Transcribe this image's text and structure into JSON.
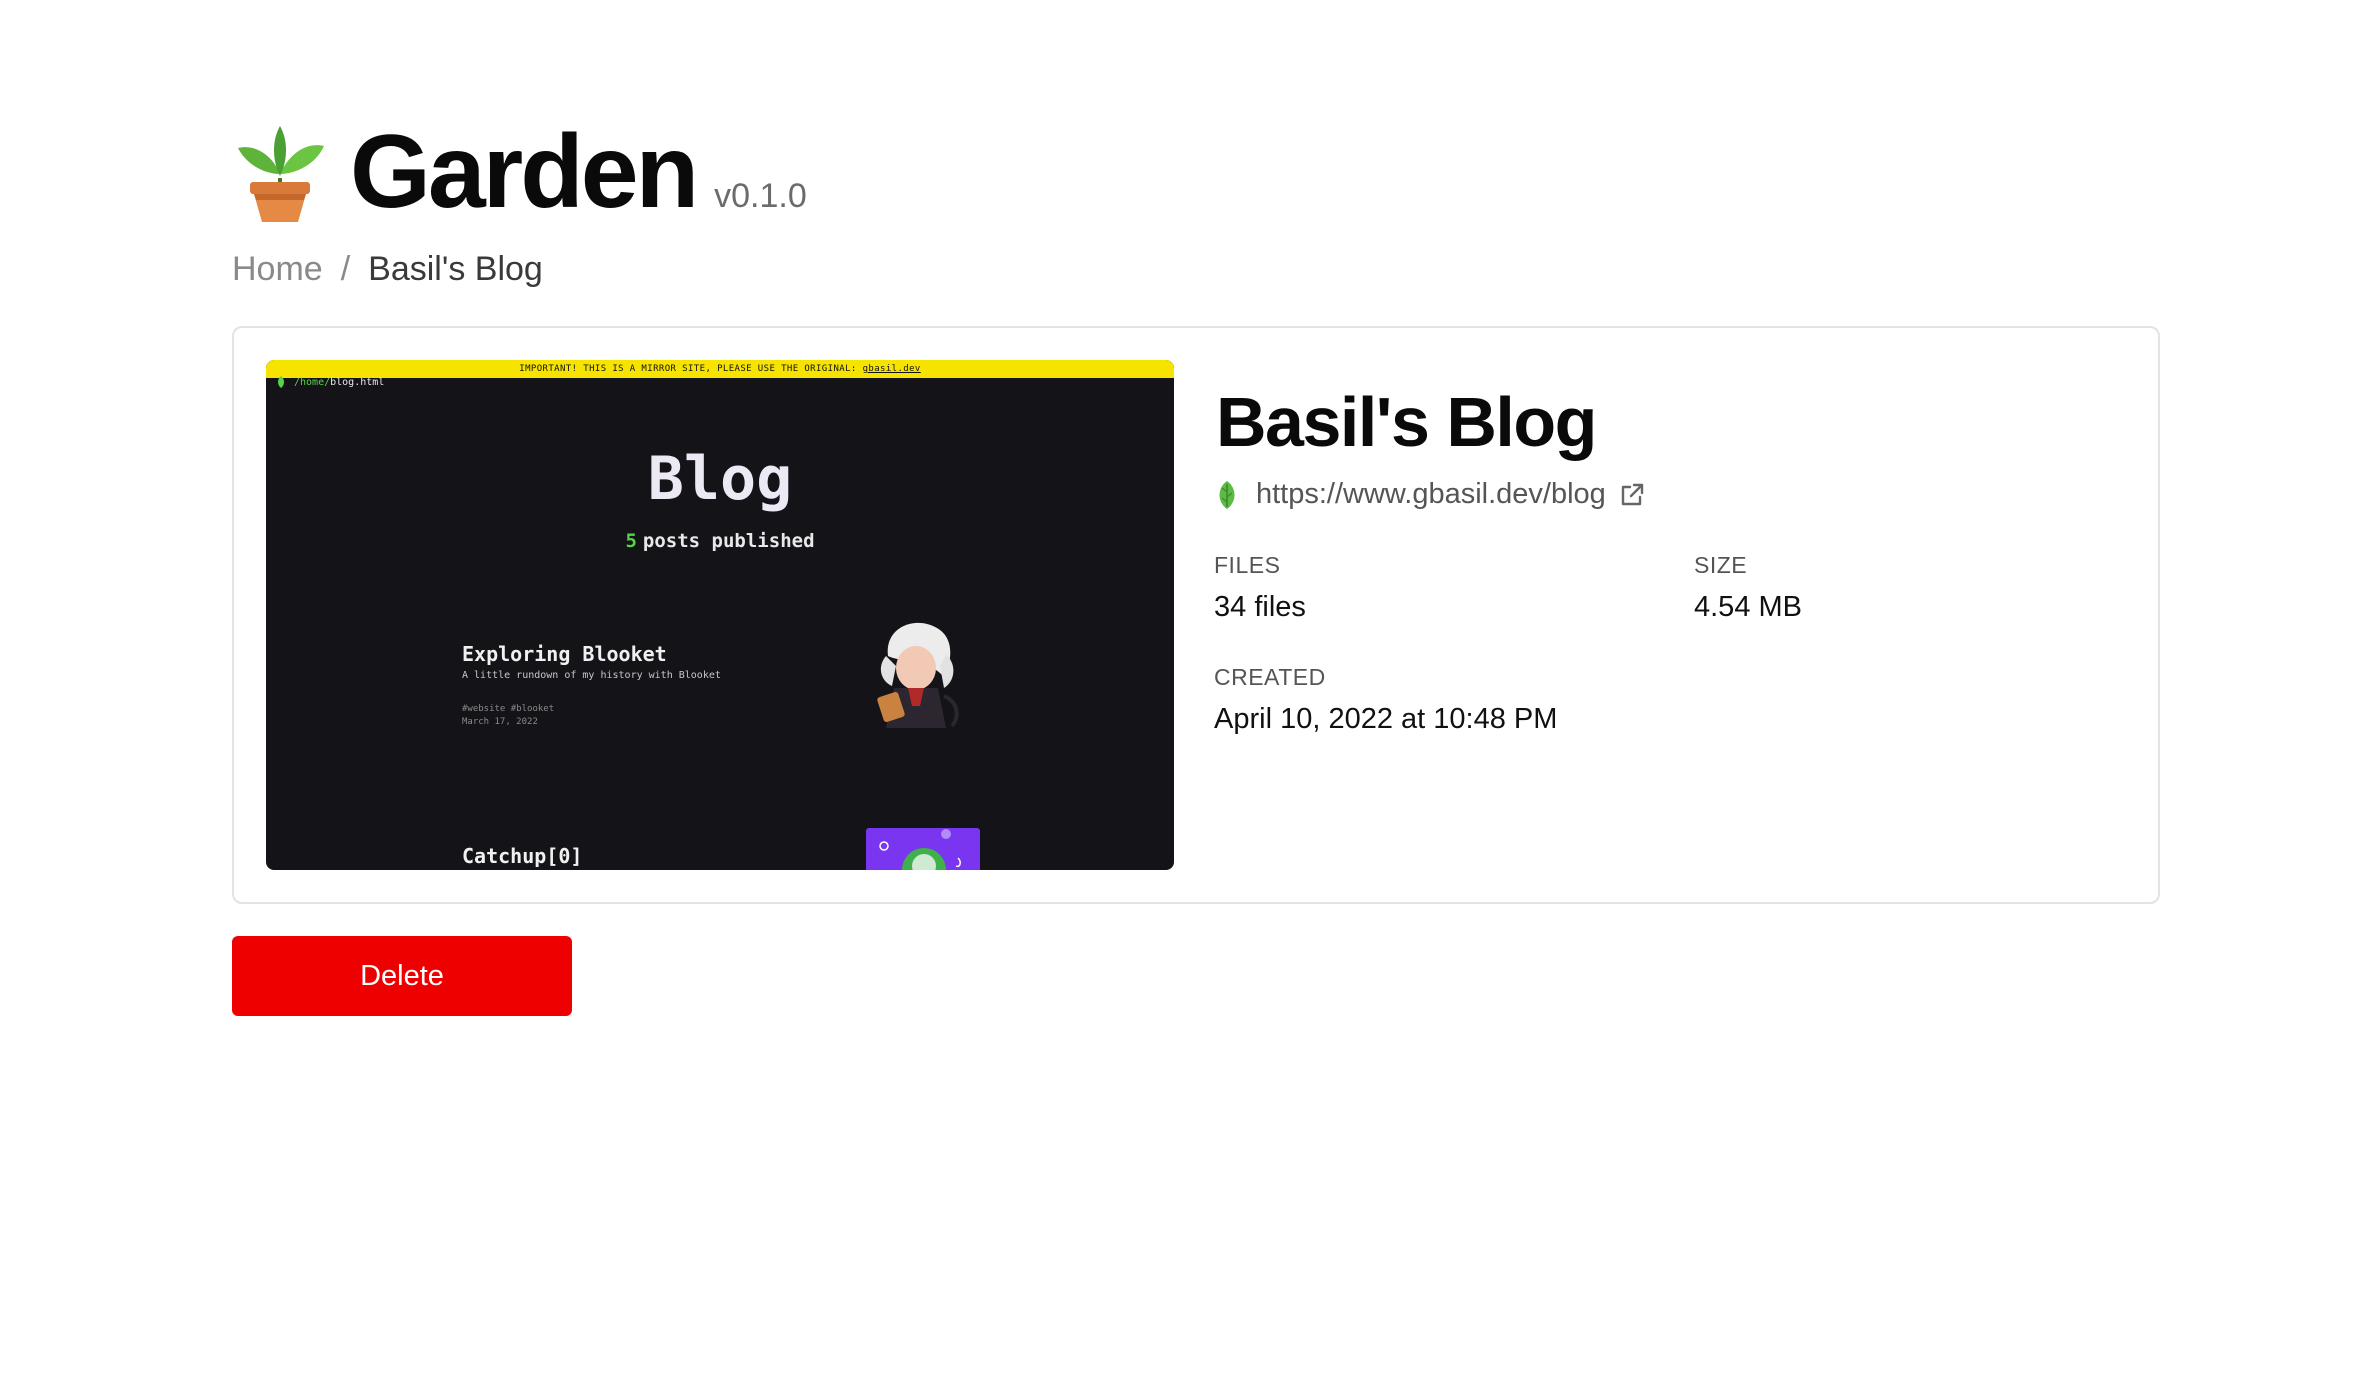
{
  "header": {
    "title": "Garden",
    "version": "v0.1.0",
    "logo_icon": "potted-plant-icon"
  },
  "breadcrumb": {
    "home": "Home",
    "separator": "/",
    "current": "Basil's Blog"
  },
  "site": {
    "title": "Basil's Blog",
    "url": "https://www.gbasil.dev/blog",
    "favicon": "leaf-icon",
    "external_icon": "external-link-icon"
  },
  "meta": {
    "files_label": "FILES",
    "files_value": "34 files",
    "size_label": "SIZE",
    "size_value": "4.54 MB",
    "created_label": "CREATED",
    "created_value": "April 10, 2022 at 10:48 PM"
  },
  "preview": {
    "banner_text": "IMPORTANT! THIS IS A MIRROR SITE, PLEASE USE THE ORIGINAL:",
    "banner_link": "gbasil.dev",
    "path_home": "/home/",
    "path_file": "blog.html",
    "title": "Blog",
    "post_count": "5",
    "post_count_suffix": "posts published",
    "post1_title": "Exploring Blooket",
    "post1_desc": "A little rundown of my history with Blooket",
    "post1_tags": "#website #blooket",
    "post1_date": "March 17, 2022",
    "post2_title": "Catchup[0]"
  },
  "actions": {
    "delete_label": "Delete"
  },
  "colors": {
    "danger": "#ef0000",
    "accent_green": "#58d24a",
    "banner_yellow": "#f7e300"
  }
}
